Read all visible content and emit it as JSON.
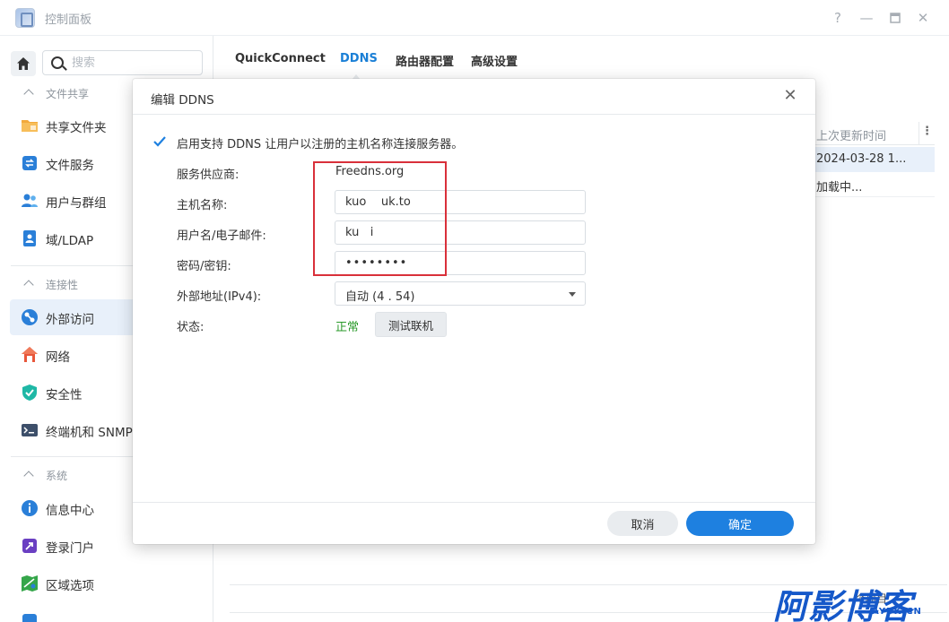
{
  "window": {
    "title": "控制面板"
  },
  "sidebar": {
    "search_placeholder": "搜索",
    "sections": [
      {
        "label": "文件共享",
        "items": [
          "共享文件夹",
          "文件服务",
          "用户与群组",
          "域/LDAP"
        ]
      },
      {
        "label": "连接性",
        "items": [
          "外部访问",
          "网络",
          "安全性",
          "终端机和 SNMP"
        ]
      },
      {
        "label": "系统",
        "items": [
          "信息中心",
          "登录门户",
          "区域选项"
        ]
      }
    ],
    "active_item": "外部访问"
  },
  "tabs": [
    "QuickConnect",
    "DDNS",
    "路由器配置",
    "高级设置"
  ],
  "active_tab": "DDNS",
  "table": {
    "column_header": "上次更新时间",
    "rows": [
      "2024-03-28 1...",
      "加载中..."
    ]
  },
  "dialog": {
    "title": "编辑 DDNS",
    "enable_label": "启用支持 DDNS 让用户以注册的主机名称连接服务器。",
    "enabled": true,
    "fields": {
      "provider": {
        "label": "服务供应商:",
        "value": "Freedns.org"
      },
      "hostname": {
        "label": "主机名称:",
        "value": "kuo    uk.to"
      },
      "username": {
        "label": "用户名/电子邮件:",
        "value": "ku   i"
      },
      "password": {
        "label": "密码/密钥:",
        "value": "••••••••"
      },
      "external_ip": {
        "label": "外部地址(IPv4):",
        "value": "自动 (4    .     54)"
      },
      "status": {
        "label": "状态:",
        "value": "正常"
      }
    },
    "test_button": "测试联机",
    "cancel_button": "取消",
    "ok_button": "确定"
  },
  "footer": {
    "partial_text": "个项目"
  },
  "watermark": {
    "main": "阿影博客",
    "sub": "AYBK.CN"
  },
  "colors": {
    "accent": "#1e80e0",
    "status_ok": "#2a9a2a",
    "highlight_box": "#d9303a"
  }
}
